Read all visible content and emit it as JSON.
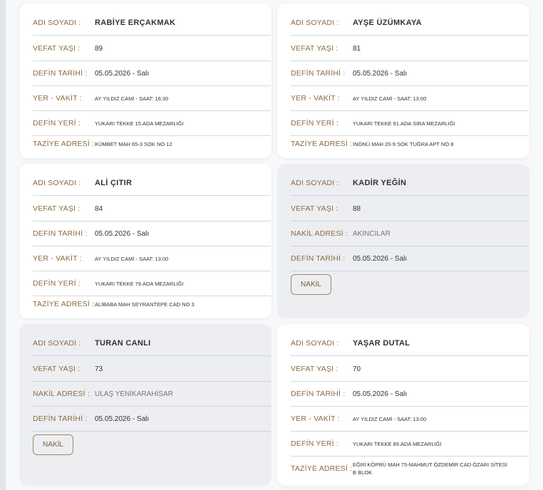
{
  "labels": {
    "name": "ADI SOYADI :",
    "age": "VEFAT YAŞI :",
    "burial_date": "DEFİN TARİHİ :",
    "place_time": "YER - VAKİT :",
    "burial_place": "DEFİN YERİ :",
    "condolence": "TAZİYE ADRESİ :",
    "transfer": "NAKİL ADRESİ :"
  },
  "cards": [
    {
      "name": "RABİYE ERÇAKMAK",
      "age": "89",
      "burial_date": "05.05.2026 - Salı",
      "place_time": "AY YILDIZ CAMİ - SAAT: 16:30",
      "burial_place": "YUKARI TEKKE 15.ADA MEZARLIĞI",
      "condolence": "KÜMBET MAH 65-3 SOK NO 12"
    },
    {
      "name": "AYŞE ÜZÜMKAYA",
      "age": "81",
      "burial_date": "05.05.2026 - Salı",
      "place_time": "AY YILDIZ CAMİ - SAAT: 13:00",
      "burial_place": "YUKARI TEKKE 91.ADA SIRA MEZARLIĞI",
      "condolence": "İNÖNÜ MAH 20-9 SOK TUĞRA APT NO 8"
    },
    {
      "name": "ALİ ÇITIR",
      "age": "84",
      "burial_date": "05.05.2026 - Salı",
      "place_time": "AY YILDIZ CAMİ - SAAT: 13:00",
      "burial_place": "YUKARI TEKKE 79.ADA MEZARLIĞI",
      "condolence": "ALİBABA MAH SEYRANTEPE CAD NO 3"
    },
    {
      "name": "KADİR YEĞİN",
      "age": "88",
      "transfer": "AKINCILAR",
      "burial_date": "05.05.2026 - Salı",
      "button": "NAKİL"
    },
    {
      "name": "TURAN CANLI",
      "age": "73",
      "transfer": "ULAŞ YENİKARAHİSAR",
      "burial_date": "05.05.2026 - Salı",
      "button": "NAKİL"
    },
    {
      "name": "YAŞAR DUTAL",
      "age": "70",
      "burial_date": "05.05.2026 - Salı",
      "place_time": "AY YILDIZ CAMİ - SAAT: 13:00",
      "burial_place": "YUKARI TEKKE 89.ADA MEZARLIĞI",
      "condolence": "EĞRİ KÖPRÜ MAH 75-MAHMUT ÖZDEMİR CAD ÖZARI SİTESİ B BLOK"
    }
  ],
  "colors": {
    "label": "#8b6b3f",
    "card_white": "#ffffff",
    "card_gray": "#eceef2",
    "button_border": "#a38660"
  }
}
